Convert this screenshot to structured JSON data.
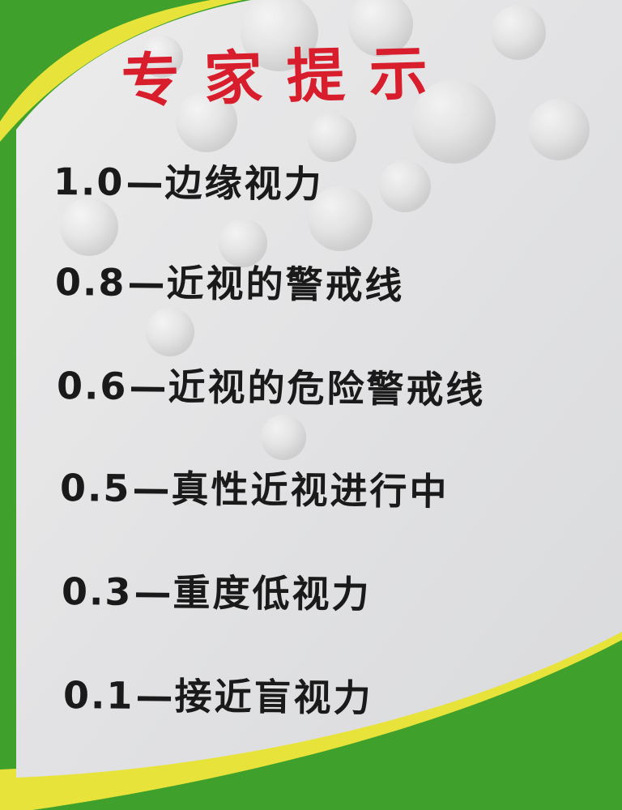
{
  "poster": {
    "title": "专家提示",
    "tips": [
      {
        "value": "1.0",
        "separator": "—",
        "label": "边缘视力"
      },
      {
        "value": "0.8",
        "separator": "—",
        "label": "近视的警戒线"
      },
      {
        "value": "0.6",
        "separator": "—",
        "label": "近视的危险警戒线"
      },
      {
        "value": "0.5",
        "separator": "—",
        "label": "真性近视进行中"
      },
      {
        "value": "0.3",
        "separator": "—",
        "label": "重度低视力"
      },
      {
        "value": "0.1",
        "separator": "—",
        "label": "接近盲视力"
      }
    ]
  },
  "colors": {
    "title": "#d81e2c",
    "text": "#1a1a1a",
    "panel": "#e6e6e6",
    "green": "#3fa12c",
    "yellow_stripe": "#e8e33a"
  }
}
